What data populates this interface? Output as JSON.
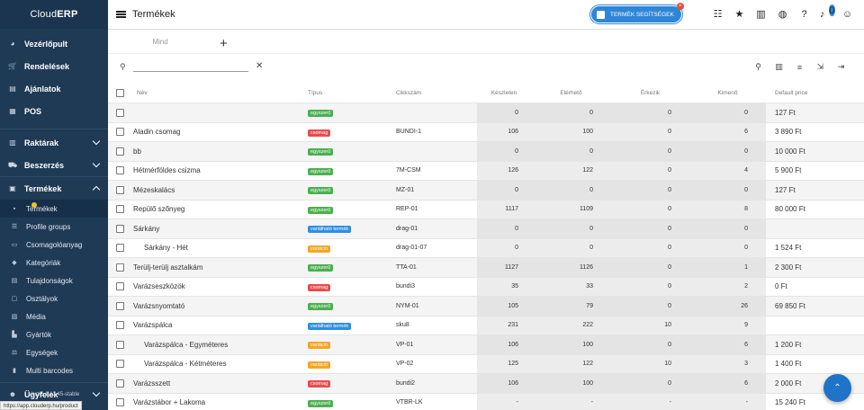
{
  "app": {
    "brand_light": "Cloud",
    "brand_bold": "ERP"
  },
  "sidebar": {
    "main_items": [
      {
        "label": "Vezérlőpult",
        "icon": "dashboard-icon",
        "glyph": "◕"
      },
      {
        "label": "Rendelések",
        "icon": "cart-icon",
        "glyph": "🛒"
      },
      {
        "label": "Ajánlatok",
        "icon": "document-icon",
        "glyph": "▤"
      },
      {
        "label": "POS",
        "icon": "pos-icon",
        "glyph": "▦"
      }
    ],
    "group_items": [
      {
        "label": "Raktárak",
        "icon": "warehouse-icon",
        "glyph": "▥"
      },
      {
        "label": "Beszerzés",
        "icon": "truck-icon",
        "glyph": "⛟"
      }
    ],
    "products": {
      "label": "Termékek",
      "icon": "products-icon",
      "glyph": "▣"
    },
    "product_sub": [
      {
        "label": "Termékek",
        "icon": "products-sub-icon",
        "glyph": "▪"
      },
      {
        "label": "Profile groups",
        "icon": "profile-groups-icon",
        "glyph": "☰"
      },
      {
        "label": "Csomagolóanyag",
        "icon": "package-icon",
        "glyph": "▭"
      },
      {
        "label": "Kategóriák",
        "icon": "tag-icon",
        "glyph": "◆"
      },
      {
        "label": "Tulajdonságok",
        "icon": "properties-icon",
        "glyph": "▤"
      },
      {
        "label": "Osztályok",
        "icon": "class-icon",
        "glyph": "▢"
      },
      {
        "label": "Média",
        "icon": "media-icon",
        "glyph": "▧"
      },
      {
        "label": "Gyártók",
        "icon": "factory-icon",
        "glyph": "▙"
      },
      {
        "label": "Egységek",
        "icon": "scale-icon",
        "glyph": "⚖"
      },
      {
        "label": "Multi barcodes",
        "icon": "barcode-icon",
        "glyph": "▮"
      }
    ],
    "customers": {
      "label": "Ügyfelek",
      "icon": "customers-icon",
      "glyph": "👥"
    },
    "version": "Verzió 1.13.45-stable",
    "status_url": "https://app.clouderp.hu/product"
  },
  "header": {
    "title": "Termékek",
    "help_button": "TERMÉK SEGÍTSÉGEK",
    "help_close": "×",
    "notification_count": "0"
  },
  "tabs": {
    "all": "Mind",
    "add": "+"
  },
  "search": {
    "value": "",
    "placeholder": ""
  },
  "table": {
    "columns": {
      "name": "Név",
      "type": "Típus",
      "sku": "Cikkszám",
      "stock": "Készleten",
      "forecast": "Elérhető",
      "incoming": "Érkezik",
      "outgoing": "Kimenő",
      "price": "Default price"
    },
    "rows": [
      {
        "name": "",
        "type": "egyszerű",
        "type_color": "#4caf50",
        "sku": "",
        "stock": "0",
        "forecast": "0",
        "incoming": "0",
        "outgoing": "0",
        "price": "127 Ft",
        "indent": false
      },
      {
        "name": "Aladin csomag",
        "type": "csomag",
        "type_color": "#e84c4c",
        "sku": "BUNDI-1",
        "stock": "106",
        "forecast": "100",
        "incoming": "0",
        "outgoing": "6",
        "price": "3 890 Ft",
        "indent": false
      },
      {
        "name": "bb",
        "type": "egyszerű",
        "type_color": "#4caf50",
        "sku": "",
        "stock": "0",
        "forecast": "0",
        "incoming": "0",
        "outgoing": "0",
        "price": "10 000 Ft",
        "indent": false
      },
      {
        "name": "Hétmérföldes csizma",
        "type": "egyszerű",
        "type_color": "#4caf50",
        "sku": "7M-CSM",
        "stock": "126",
        "forecast": "122",
        "incoming": "0",
        "outgoing": "4",
        "price": "5 900 Ft",
        "indent": false
      },
      {
        "name": "Mézeskalács",
        "type": "egyszerű",
        "type_color": "#4caf50",
        "sku": "MZ-01",
        "stock": "0",
        "forecast": "0",
        "incoming": "0",
        "outgoing": "0",
        "price": "127 Ft",
        "indent": false
      },
      {
        "name": "Repülő szőnyeg",
        "type": "egyszerű",
        "type_color": "#4caf50",
        "sku": "REP-01",
        "stock": "1117",
        "forecast": "1109",
        "incoming": "0",
        "outgoing": "8",
        "price": "80 000 Ft",
        "indent": false
      },
      {
        "name": "Sárkány",
        "type": "variálható termék",
        "type_color": "#2f8fe0",
        "sku": "drag-01",
        "stock": "0",
        "forecast": "0",
        "incoming": "0",
        "outgoing": "0",
        "price": "",
        "indent": false
      },
      {
        "name": "Sárkány - Hét",
        "type": "variáció",
        "type_color": "#f5a623",
        "sku": "drag-01-07",
        "stock": "0",
        "forecast": "0",
        "incoming": "0",
        "outgoing": "0",
        "price": "1 524 Ft",
        "indent": true
      },
      {
        "name": "Terülj-terülj asztalkám",
        "type": "egyszerű",
        "type_color": "#4caf50",
        "sku": "TTA-01",
        "stock": "1127",
        "forecast": "1126",
        "incoming": "0",
        "outgoing": "1",
        "price": "2 300 Ft",
        "indent": false
      },
      {
        "name": "Varázseszközök",
        "type": "csomag",
        "type_color": "#e84c4c",
        "sku": "bundi3",
        "stock": "35",
        "forecast": "33",
        "incoming": "0",
        "outgoing": "2",
        "price": "0 Ft",
        "indent": false
      },
      {
        "name": "Varázsnyomtató",
        "type": "egyszerű",
        "type_color": "#4caf50",
        "sku": "NYM-01",
        "stock": "105",
        "forecast": "79",
        "incoming": "0",
        "outgoing": "26",
        "price": "69 850 Ft",
        "indent": false
      },
      {
        "name": "Varázspálca",
        "type": "variálható termék",
        "type_color": "#2f8fe0",
        "sku": "sku8",
        "stock": "231",
        "forecast": "222",
        "incoming": "10",
        "outgoing": "9",
        "price": "",
        "indent": false
      },
      {
        "name": "Varázspálca - Egyméteres",
        "type": "variáció",
        "type_color": "#f5a623",
        "sku": "VP-01",
        "stock": "106",
        "forecast": "100",
        "incoming": "0",
        "outgoing": "6",
        "price": "1 200 Ft",
        "indent": true
      },
      {
        "name": "Varázspálca - Kétméteres",
        "type": "variáció",
        "type_color": "#f5a623",
        "sku": "VP-02",
        "stock": "125",
        "forecast": "122",
        "incoming": "10",
        "outgoing": "3",
        "price": "1 400 Ft",
        "indent": true
      },
      {
        "name": "Varázsszett",
        "type": "csomag",
        "type_color": "#e84c4c",
        "sku": "bundi2",
        "stock": "106",
        "forecast": "100",
        "incoming": "0",
        "outgoing": "6",
        "price": "2 000 Ft",
        "indent": false
      },
      {
        "name": "Varázstábor + Lakoma",
        "type": "egyszerű",
        "type_color": "#4caf50",
        "sku": "VTBR-LK",
        "stock": "-",
        "forecast": "-",
        "incoming": "-",
        "outgoing": "-",
        "price": "15 240 Ft",
        "indent": false
      }
    ]
  },
  "fab": {
    "label": "⌃",
    "icon": "scroll-top-icon"
  }
}
